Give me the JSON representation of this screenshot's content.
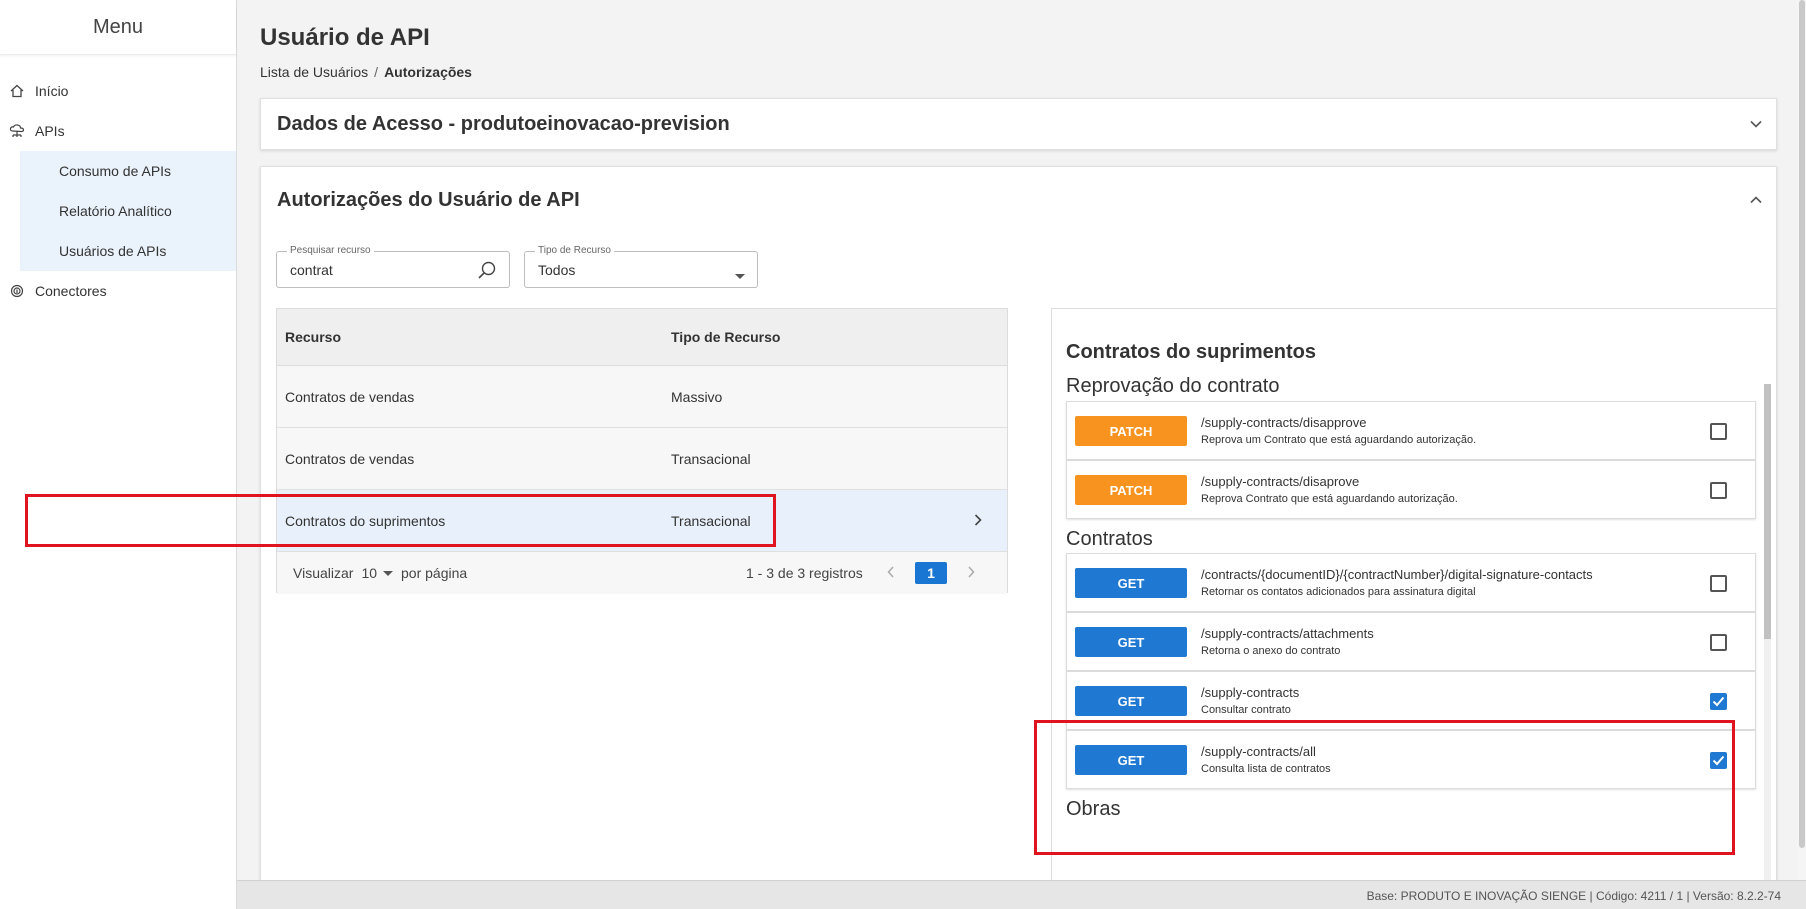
{
  "sidebar": {
    "title": "Menu",
    "items": [
      {
        "label": "Início",
        "icon": "home-icon"
      },
      {
        "label": "APIs",
        "icon": "cloud-network-icon"
      },
      {
        "label": "Conectores",
        "icon": "fingerprint-icon"
      }
    ],
    "sub_items": [
      "Consumo de APIs",
      "Relatório Analítico",
      "Usuários de APIs"
    ]
  },
  "page": {
    "title": "Usuário de API",
    "breadcrumb": {
      "parent": "Lista de Usuários",
      "separator": "/",
      "current": "Autorizações"
    }
  },
  "access_panel": {
    "title": "Dados de Acesso - produtoeinovacao-prevision",
    "expanded": false
  },
  "auth_panel": {
    "title": "Autorizações do Usuário de API",
    "expanded": true,
    "search": {
      "label": "Pesquisar recurso",
      "value": "contrat"
    },
    "type_filter": {
      "label": "Tipo de Recurso",
      "value": "Todos"
    },
    "table": {
      "headers": [
        "Recurso",
        "Tipo de Recurso"
      ],
      "rows": [
        {
          "resource": "Contratos de vendas",
          "type": "Massivo",
          "selected": false
        },
        {
          "resource": "Contratos de vendas",
          "type": "Transacional",
          "selected": false
        },
        {
          "resource": "Contratos do suprimentos",
          "type": "Transacional",
          "selected": true
        }
      ],
      "footer": {
        "show_label": "Visualizar",
        "page_size": "10",
        "per_page_label": "por página",
        "count": "1 - 3 de 3 registros",
        "current_page": "1"
      }
    }
  },
  "detail": {
    "title": "Contratos do suprimentos",
    "groups": [
      {
        "title": "Reprovação do contrato",
        "endpoints": [
          {
            "method": "PATCH",
            "path": "/supply-contracts/disapprove",
            "description": "Reprova um Contrato que está aguardando autorização.",
            "checked": false
          },
          {
            "method": "PATCH",
            "path": "/supply-contracts/disaprove",
            "description": "Reprova Contrato que está aguardando autorização.",
            "checked": false
          }
        ]
      },
      {
        "title": "Contratos",
        "endpoints": [
          {
            "method": "GET",
            "path": "/contracts/{documentID}/{contractNumber}/digital-signature-contacts",
            "description": "Retornar os contatos adicionados para assinatura digital",
            "checked": false
          },
          {
            "method": "GET",
            "path": "/supply-contracts/attachments",
            "description": "Retorna o anexo do contrato",
            "checked": false
          },
          {
            "method": "GET",
            "path": "/supply-contracts",
            "description": "Consultar contrato",
            "checked": true
          },
          {
            "method": "GET",
            "path": "/supply-contracts/all",
            "description": "Consulta lista de contratos",
            "checked": true
          }
        ]
      },
      {
        "title": "Obras",
        "endpoints": []
      }
    ]
  },
  "status_bar": {
    "text": "Base: PRODUTO E INOVAÇÃO SIENGE | Código: 4211 / 1 | Versão: 8.2.2-74"
  },
  "colors": {
    "patch": "#f7931e",
    "get": "#1f78d1",
    "highlight": "#e0141e",
    "primary": "#1976d2"
  }
}
